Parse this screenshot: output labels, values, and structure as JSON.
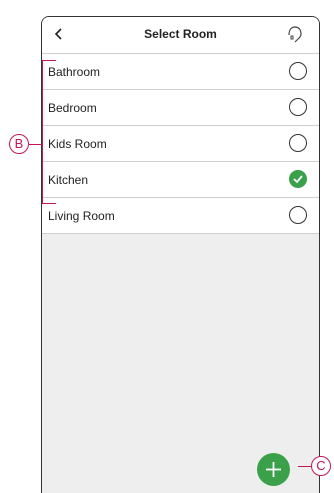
{
  "header": {
    "title": "Select Room",
    "back_icon": "chevron-left-icon",
    "help_icon": "headset-icon"
  },
  "rooms": [
    {
      "label": "Bathroom",
      "selected": false
    },
    {
      "label": "Bedroom",
      "selected": false
    },
    {
      "label": "Kids Room",
      "selected": false
    },
    {
      "label": "Kitchen",
      "selected": true
    },
    {
      "label": "Living Room",
      "selected": false
    }
  ],
  "fab": {
    "icon": "plus-icon"
  },
  "callouts": {
    "list_label": "B",
    "add_label": "C"
  },
  "colors": {
    "accent_green": "#3aa04a",
    "callout": "#c2185b"
  }
}
